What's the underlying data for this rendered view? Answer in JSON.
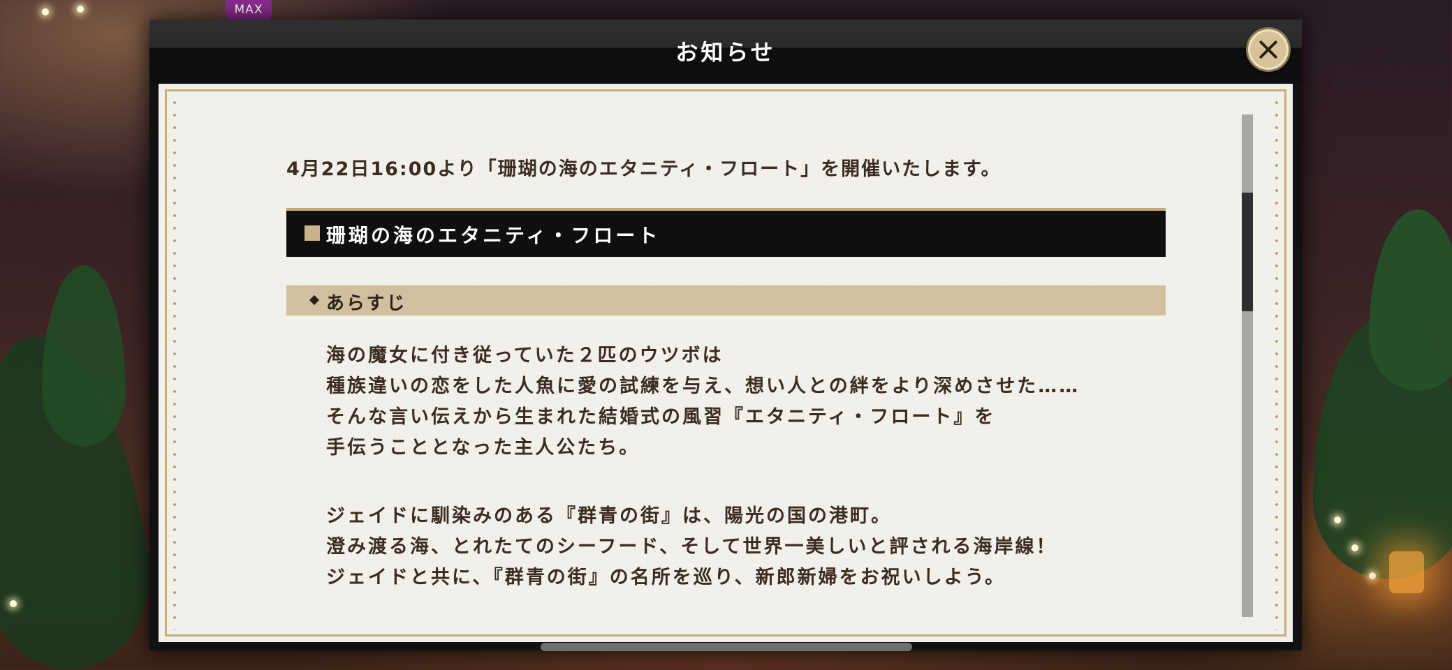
{
  "badge": {
    "label": "MAX"
  },
  "modal": {
    "title": "お知らせ",
    "close_label": "×"
  },
  "notice": {
    "intro": "4月22日16:00より「珊瑚の海のエタニティ・フロート」を開催いたします。",
    "section_title": "珊瑚の海のエタニティ・フロート",
    "subsection_title": "あらすじ",
    "paragraphs": [
      [
        "海の魔女に付き従っていた２匹のウツボは",
        "種族違いの恋をした人魚に愛の試練を与え、想い人との絆をより深めさせた……",
        "そんな言い伝えから生まれた結婚式の風習『エタニティ・フロート』を",
        "手伝うこととなった主人公たち。"
      ],
      [
        "ジェイドに馴染みのある『群青の街』は、陽光の国の港町。",
        "澄み渡る海、とれたてのシーフード、そして世界一美しいと評される海岸線！",
        "ジェイドと共に、『群青の街』の名所を巡り、新郎新婦をお祝いしよう。"
      ]
    ]
  },
  "colors": {
    "gold": "#c6ad7b",
    "header_bg": "#0f0f0f",
    "subheader_bg": "#d1c0a0",
    "paper": "#f2f0eb"
  },
  "scroll": {
    "position_fraction": 0.16
  }
}
